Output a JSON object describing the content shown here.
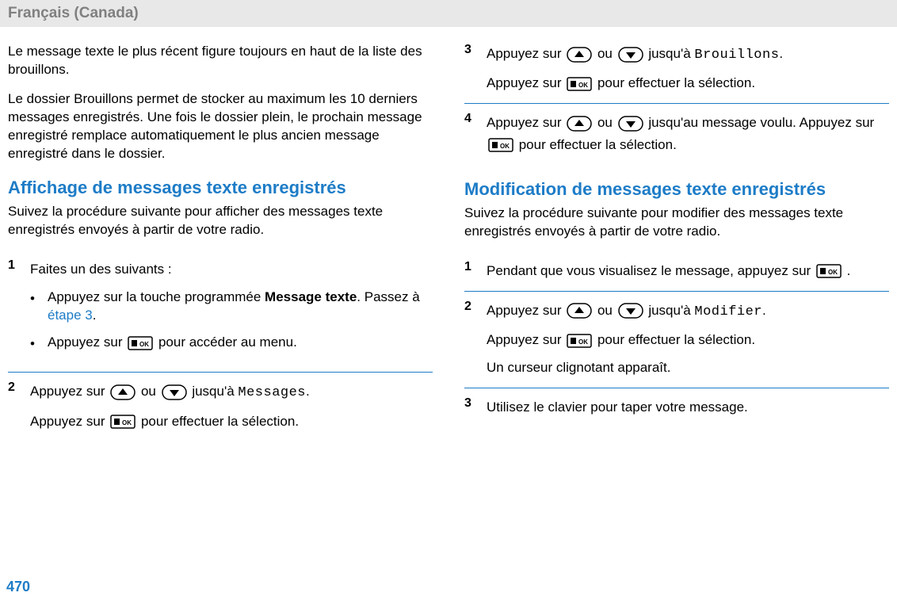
{
  "header": {
    "langlabel": "Français (Canada)"
  },
  "left": {
    "intro1": "Le message texte le plus récent figure toujours en haut de la liste des brouillons.",
    "intro2": "Le dossier Brouillons permet de stocker au maximum les 10 derniers messages enregistrés. Une fois le dossier plein, le prochain message enregistré remplace automatiquement le plus ancien message enregistré dans le dossier.",
    "h2": "Affichage de messages texte enregistrés",
    "lead": "Suivez la procédure suivante pour afficher des messages texte enregistrés envoyés à partir de votre radio.",
    "step1": {
      "num": "1",
      "text": "Faites un des suivants :",
      "sub1a": "Appuyez sur la touche programmée ",
      "sub1b": "Message texte",
      "sub1c": ". Passez à ",
      "sub1link": "étape 3",
      "sub1d": ".",
      "sub2a": "Appuyez sur ",
      "sub2b": " pour accéder au menu."
    },
    "step2": {
      "num": "2",
      "lineA_a": "Appuyez sur ",
      "lineA_b": " ou ",
      "lineA_c": " jusqu'à ",
      "lineA_mono": "Messages",
      "lineA_d": ".",
      "lineB_a": "Appuyez sur ",
      "lineB_b": " pour effectuer la sélection."
    }
  },
  "right": {
    "step3": {
      "num": "3",
      "lineA_a": "Appuyez sur ",
      "lineA_b": " ou ",
      "lineA_c": " jusqu'à ",
      "lineA_mono": "Brouillons",
      "lineA_d": ".",
      "lineB_a": "Appuyez sur ",
      "lineB_b": " pour effectuer la sélection."
    },
    "step4": {
      "num": "4",
      "lineA_a": "Appuyez sur ",
      "lineA_b": " ou ",
      "lineA_c": " jusqu'au message voulu. Appuyez sur ",
      "lineA_d": " pour effectuer la sélection."
    },
    "h2": "Modification de messages texte enregistrés",
    "lead": "Suivez la procédure suivante pour modifier des messages texte enregistrés envoyés à partir de votre radio.",
    "mstep1": {
      "num": "1",
      "a": "Pendant que vous visualisez le message, appuyez sur ",
      "b": " ."
    },
    "mstep2": {
      "num": "2",
      "lineA_a": "Appuyez sur ",
      "lineA_b": " ou ",
      "lineA_c": " jusqu'à ",
      "lineA_mono": "Modifier",
      "lineA_d": ".",
      "lineB_a": "Appuyez sur ",
      "lineB_b": " pour effectuer la sélection.",
      "lineC": "Un curseur clignotant apparaît."
    },
    "mstep3": {
      "num": "3",
      "text": "Utilisez le clavier pour taper votre message."
    }
  },
  "icons": {
    "ok_text": "OK"
  },
  "pagenum": "470"
}
